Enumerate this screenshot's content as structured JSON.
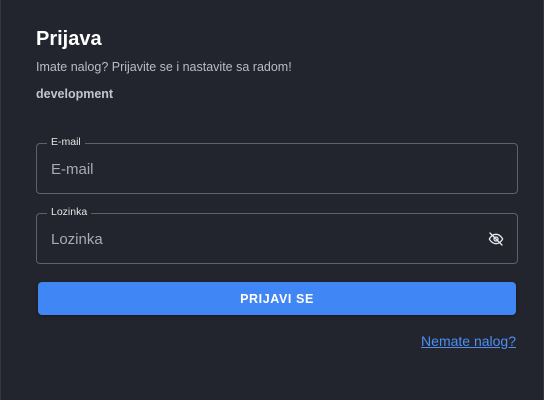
{
  "login": {
    "title": "Prijava",
    "subtitle": "Imate nalog? Prijavite se i nastavite sa radom!",
    "environment": "development",
    "email": {
      "label": "E-mail",
      "placeholder": "E-mail",
      "value": ""
    },
    "password": {
      "label": "Lozinka",
      "placeholder": "Lozinka",
      "value": "",
      "toggle_icon": "eye-off-icon"
    },
    "submit_label": "PRIJAVI SE",
    "register_link": "Nemate nalog?"
  },
  "colors": {
    "background": "#22252d",
    "accent": "#4086f4",
    "link": "#4d8ff5"
  }
}
